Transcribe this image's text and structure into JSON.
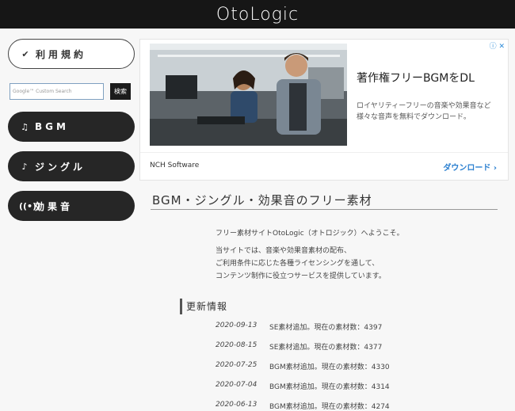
{
  "header": {
    "logo": "OtoLogic"
  },
  "sidebar": {
    "terms_label": "利用規約",
    "search": {
      "placeholder": "Google™ Custom Search",
      "button": "検索"
    },
    "items": [
      {
        "label": "BGM",
        "icon": "music-note-icon"
      },
      {
        "label": "ジングル",
        "icon": "single-note-icon"
      },
      {
        "label": "効果音",
        "icon": "broadcast-icon"
      }
    ]
  },
  "ad": {
    "badge": "ⓘ ✕",
    "headline": "著作権フリーBGMをDL",
    "description": "ロイヤリティーフリーの音楽や効果音など 様々な音声を無料でダウンロード。",
    "advertiser": "NCH Software",
    "cta": "ダウンロード ›"
  },
  "main": {
    "title": "BGM・ジングル・効果音のフリー素材",
    "intro_1": "フリー素材サイトOtoLogic（オトロジック）へようこそ。",
    "intro_2": "当サイトでは、音楽や効果音素材の配布、",
    "intro_3": "ご利用条件に応じた各種ライセンシングを通して、",
    "intro_4": "コンテンツ制作に役立つサービスを提供しています。"
  },
  "news": {
    "heading": "更新情報",
    "items": [
      {
        "date": "2020-09-13",
        "text": "SE素材追加。現在の素材数：4397"
      },
      {
        "date": "2020-08-15",
        "text": "SE素材追加。現在の素材数：4377"
      },
      {
        "date": "2020-07-25",
        "text": "BGM素材追加。現在の素材数：4330"
      },
      {
        "date": "2020-07-04",
        "text": "BGM素材追加。現在の素材数：4314"
      },
      {
        "date": "2020-06-13",
        "text": "BGM素材追加。現在の素材数：4274"
      }
    ]
  }
}
